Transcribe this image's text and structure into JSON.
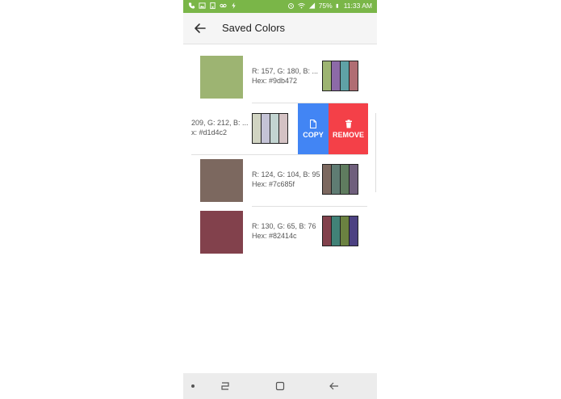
{
  "status_bar": {
    "battery": "75%",
    "time": "11:33 AM"
  },
  "app_bar": {
    "title": "Saved Colors",
    "back_icon": "arrow-back-icon"
  },
  "colors": [
    {
      "rgb": "R: 157, G: 180, B: ...",
      "hex": "Hex: #9db472",
      "swatch": "#9db472",
      "palette": [
        "#9db472",
        "#8c6aa8",
        "#5fa2a6",
        "#b06d73"
      ]
    },
    {
      "rgb": "209, G: 212, B: ...",
      "hex": "x: #d1d4c2",
      "swatch": "#d1d4c2",
      "palette": [
        "#d1d4c2",
        "#c4c3d6",
        "#c2d4d1",
        "#d4c2c4"
      ]
    },
    {
      "rgb": "R: 124, G: 104, B: 95",
      "hex": "Hex: #7c685f",
      "swatch": "#7c685f",
      "palette": [
        "#7c685f",
        "#5f7c73",
        "#5f7c5f",
        "#6f5f7c"
      ]
    },
    {
      "rgb": "R: 130, G: 65, B: 76",
      "hex": "Hex: #82414c",
      "swatch": "#82414c",
      "palette": [
        "#82414c",
        "#418277",
        "#6b8241",
        "#4c4182"
      ]
    }
  ],
  "actions": {
    "copy_label": "COPY",
    "remove_label": "REMOVE",
    "copy_color": "#4285f4",
    "remove_color": "#f44048"
  },
  "colors_theme": {
    "status_bar": "#7ab648",
    "app_bar": "#f5f5f5"
  }
}
